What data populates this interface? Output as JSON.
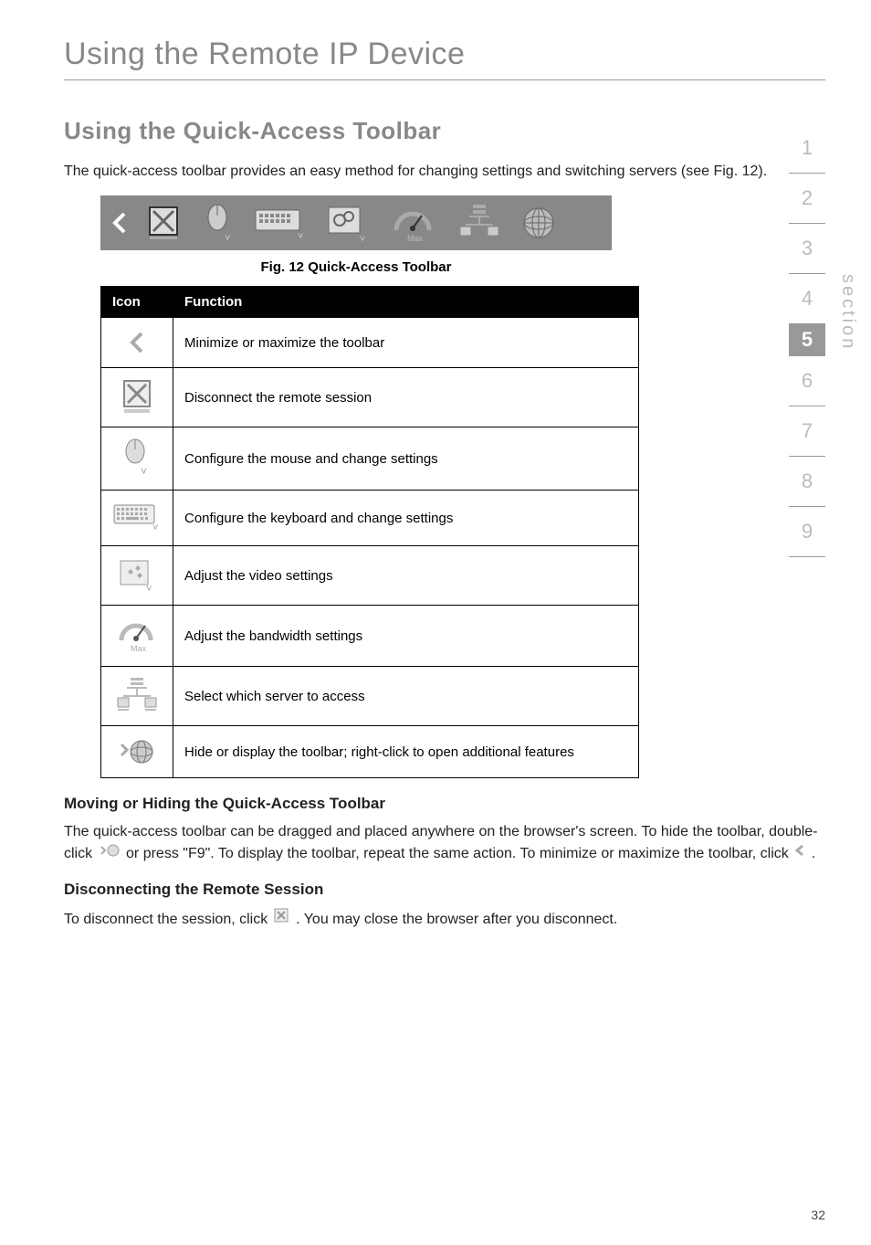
{
  "page": {
    "title": "Using the Remote IP Device",
    "number": "32"
  },
  "section": {
    "heading": "Using the Quick-Access Toolbar",
    "intro": "The quick-access toolbar provides an easy method for changing settings and switching servers (see Fig. 12).",
    "caption": "Fig. 12 Quick-Access Toolbar"
  },
  "table": {
    "header_icon": "Icon",
    "header_function": "Function",
    "rows": [
      {
        "function": "Minimize or maximize the toolbar"
      },
      {
        "function": "Disconnect the remote session"
      },
      {
        "function": "Configure the mouse and change settings"
      },
      {
        "function": "Configure the keyboard and change settings"
      },
      {
        "function": "Adjust the video settings"
      },
      {
        "function": "Adjust the bandwidth settings"
      },
      {
        "function": "Select which server to access"
      },
      {
        "function": "Hide or display the toolbar; right-click to open additional features"
      }
    ]
  },
  "moving": {
    "heading": "Moving or Hiding the Quick-Access Toolbar",
    "text_before_icon1": "The quick-access toolbar can be dragged and placed anywhere on the browser's screen. To hide the toolbar, double-click ",
    "text_mid": " or press \"F9\". To display the toolbar, repeat the same action. To minimize or maximize the toolbar, click ",
    "text_after": " ."
  },
  "disconnect": {
    "heading": "Disconnecting the Remote Session",
    "text_before": "To disconnect the session, click ",
    "text_after": ". You may close the browser after you disconnect."
  },
  "nav": {
    "items": [
      "1",
      "2",
      "3",
      "4",
      "5",
      "6",
      "7",
      "8",
      "9"
    ],
    "active_index": 4,
    "label": "section"
  }
}
